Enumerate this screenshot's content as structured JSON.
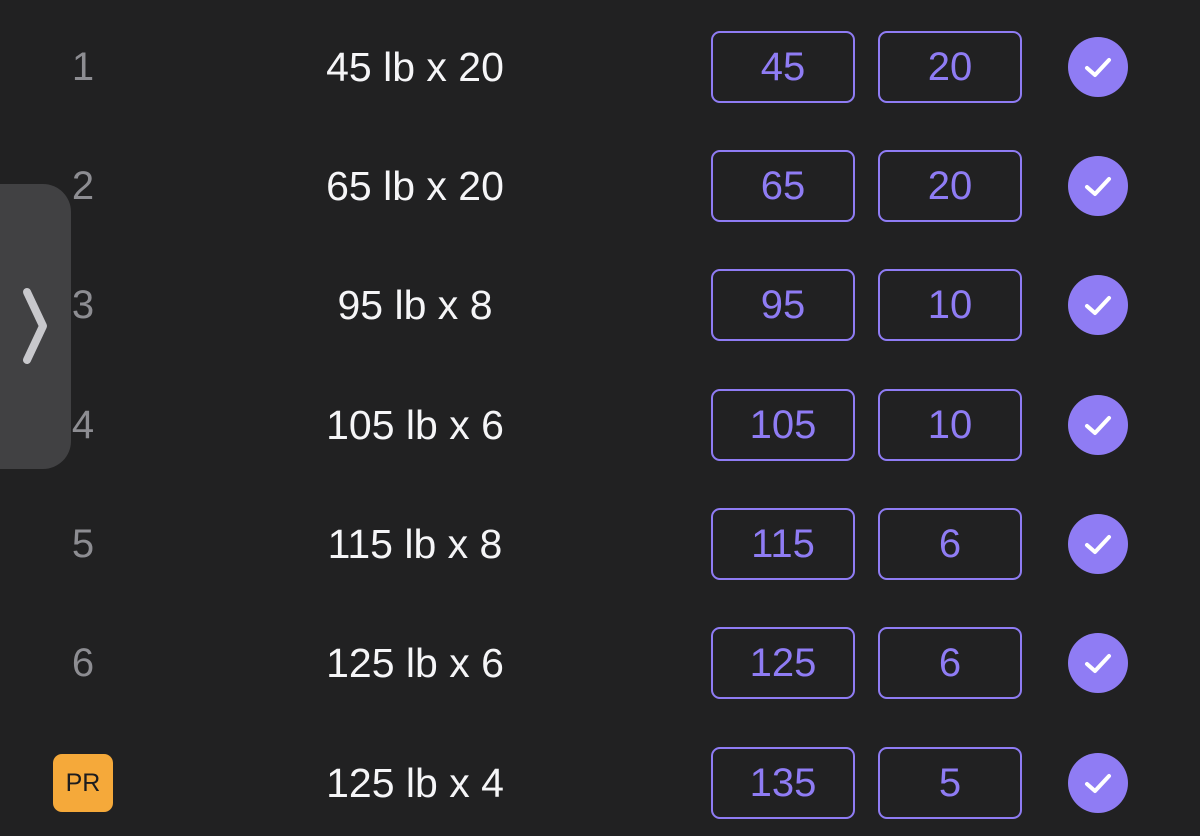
{
  "sets": [
    {
      "set_label": "1",
      "is_pr": false,
      "previous": "45 lb x 20",
      "weight": "45",
      "reps": "20",
      "completed": true
    },
    {
      "set_label": "2",
      "is_pr": false,
      "previous": "65 lb x 20",
      "weight": "65",
      "reps": "20",
      "completed": true
    },
    {
      "set_label": "3",
      "is_pr": false,
      "previous": "95 lb x 8",
      "weight": "95",
      "reps": "10",
      "completed": true
    },
    {
      "set_label": "4",
      "is_pr": false,
      "previous": "105 lb x 6",
      "weight": "105",
      "reps": "10",
      "completed": true
    },
    {
      "set_label": "5",
      "is_pr": false,
      "previous": "115 lb x 8",
      "weight": "115",
      "reps": "6",
      "completed": true
    },
    {
      "set_label": "6",
      "is_pr": false,
      "previous": "125 lb x 6",
      "weight": "125",
      "reps": "6",
      "completed": true
    },
    {
      "set_label": "PR",
      "is_pr": true,
      "previous": "125 lb x 4",
      "weight": "135",
      "reps": "5",
      "completed": true
    }
  ],
  "icons": {
    "check": "checkmark-icon",
    "side_handle": "chevron-right-icon"
  },
  "colors": {
    "background": "#212122",
    "accent": "#8f7cf4",
    "pr_badge": "#f5a93a",
    "primary_text": "#f5f5f7",
    "secondary_text": "#8d8d92"
  }
}
